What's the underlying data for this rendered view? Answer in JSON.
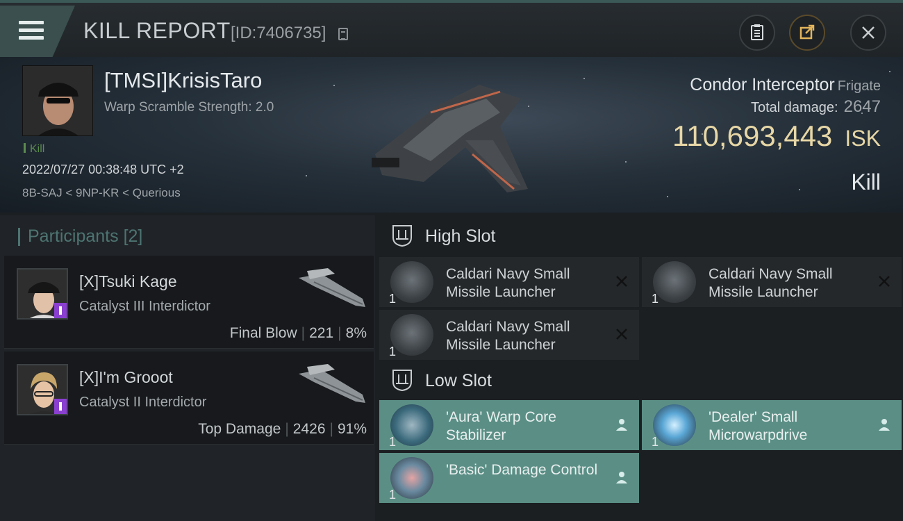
{
  "header": {
    "title": "KILL REPORT",
    "id_text": "[ID:7406735]"
  },
  "victim": {
    "name": "[TMSI]KrisisTaro",
    "warp_scramble": "Warp Scramble Strength: 2.0",
    "kill_tag": "Kill",
    "timestamp": "2022/07/27 00:38:48 UTC +2",
    "location": "8B-SAJ < 9NP-KR < Querious"
  },
  "ship": {
    "name": "Condor Interceptor",
    "class": "Frigate",
    "total_damage_label": "Total damage:",
    "total_damage": "2647",
    "isk_value": "110,693,443",
    "isk_unit": "ISK",
    "result": "Kill"
  },
  "participants": {
    "title": "Participants",
    "count": "[2]",
    "items": [
      {
        "name": "[X]Tsuki Kage",
        "ship": "Catalyst III Interdictor",
        "role": "Final Blow",
        "damage": "221",
        "percent": "8%"
      },
      {
        "name": "[X]I'm Grooot",
        "ship": "Catalyst II Interdictor",
        "role": "Top Damage",
        "damage": "2426",
        "percent": "91%"
      }
    ]
  },
  "slots": {
    "high": {
      "title": "High Slot",
      "modules": [
        {
          "name": "Caldari Navy Small Missile Launcher",
          "qty": "1",
          "status": "destroyed"
        },
        {
          "name": "Caldari Navy Small Missile Launcher",
          "qty": "1",
          "status": "destroyed"
        },
        {
          "name": "Caldari Navy Small Missile Launcher",
          "qty": "1",
          "status": "destroyed"
        }
      ]
    },
    "low": {
      "title": "Low Slot",
      "modules": [
        {
          "name": "'Aura' Warp Core Stabilizer",
          "qty": "1",
          "status": "dropped"
        },
        {
          "name": "'Dealer' Small Microwarpdrive",
          "qty": "1",
          "status": "dropped"
        },
        {
          "name": "'Basic' Damage Control",
          "qty": "1",
          "status": "dropped"
        }
      ]
    }
  },
  "colors": {
    "accent": "#4d7471",
    "isk": "#e7d7a6",
    "dropped": "#5b8f86",
    "kill": "#5b8a4e"
  }
}
